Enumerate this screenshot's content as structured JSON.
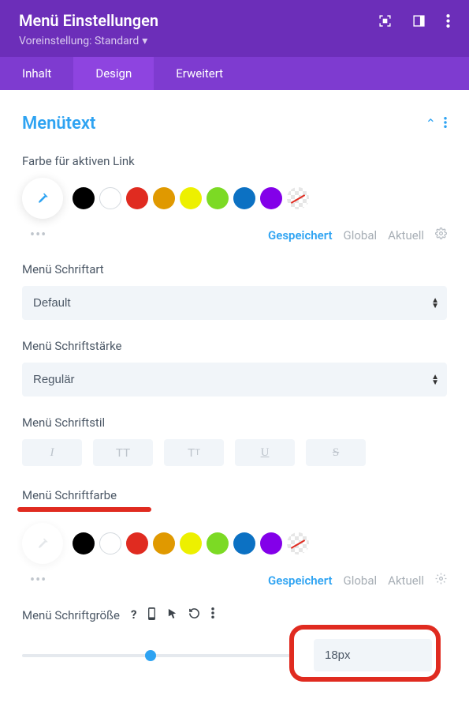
{
  "header": {
    "title": "Menü Einstellungen",
    "preset": "Voreinstellung: Standard"
  },
  "tabs": {
    "inhalt": "Inhalt",
    "design": "Design",
    "erweitert": "Erweitert"
  },
  "section": {
    "title": "Menütext"
  },
  "labels": {
    "active_link_color": "Farbe für aktiven Link",
    "font": "Menü Schriftart",
    "font_weight": "Menü Schriftstärke",
    "font_style": "Menü Schriftstil",
    "font_color": "Menü Schriftfarbe",
    "font_size": "Menü Schriftgröße"
  },
  "selects": {
    "font": "Default",
    "weight": "Regulär"
  },
  "states": {
    "saved": "Gespeichert",
    "global": "Global",
    "current": "Aktuell"
  },
  "font_size_value": "18px",
  "colors": [
    {
      "hex": "#000000",
      "name": "black"
    },
    {
      "hex": "#ffffff",
      "name": "white"
    },
    {
      "hex": "#e02b20",
      "name": "red"
    },
    {
      "hex": "#e09900",
      "name": "orange"
    },
    {
      "hex": "#edf000",
      "name": "yellow"
    },
    {
      "hex": "#7cda24",
      "name": "green"
    },
    {
      "hex": "#0c71c3",
      "name": "blue"
    },
    {
      "hex": "#8300e9",
      "name": "purple"
    }
  ]
}
